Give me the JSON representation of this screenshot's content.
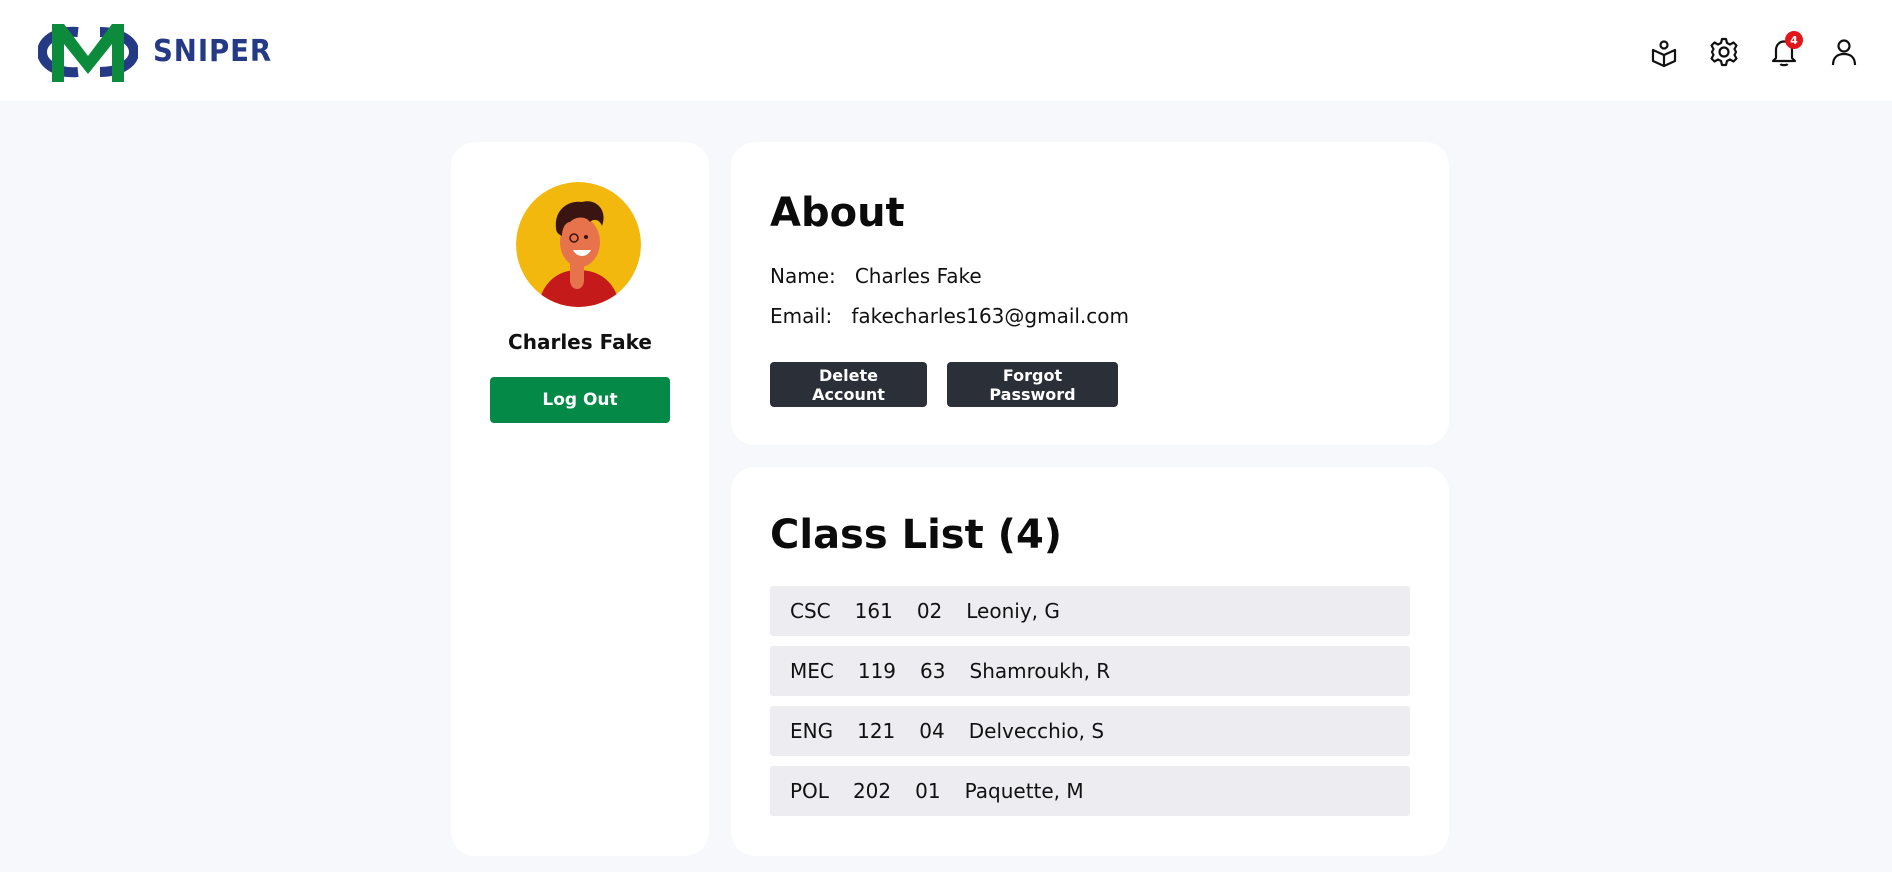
{
  "header": {
    "brand": "SNIPER",
    "logo_letters": "MC",
    "icons": [
      "reader-icon",
      "settings-icon",
      "bell-icon",
      "user-icon"
    ],
    "notification_count": "4"
  },
  "profile": {
    "name": "Charles Fake",
    "logout_label": "Log Out"
  },
  "about": {
    "title": "About",
    "name_label": "Name:",
    "name_value": "Charles Fake",
    "email_label": "Email:",
    "email_value": "fakecharles163@gmail.com",
    "delete_label": "Delete Account",
    "forgot_label": "Forgot Password"
  },
  "class_list": {
    "title": "Class List (4)",
    "rows": [
      {
        "dept": "CSC",
        "number": "161",
        "section": "02",
        "instructor": "Leoniy, G"
      },
      {
        "dept": "MEC",
        "number": "119",
        "section": "63",
        "instructor": "Shamroukh, R"
      },
      {
        "dept": "ENG",
        "number": "121",
        "section": "04",
        "instructor": "Delvecchio, S"
      },
      {
        "dept": "POL",
        "number": "202",
        "section": "01",
        "instructor": "Paquette, M"
      }
    ]
  },
  "colors": {
    "page_bg": "#f7f8fc",
    "brand_blue": "#243a84",
    "brand_green": "#048a46",
    "logout_green": "#048a46",
    "dark_button": "#2b2f38",
    "badge_red": "#e3151a",
    "avatar_yellow": "#f2b80d",
    "row_bg": "#ececf1"
  }
}
